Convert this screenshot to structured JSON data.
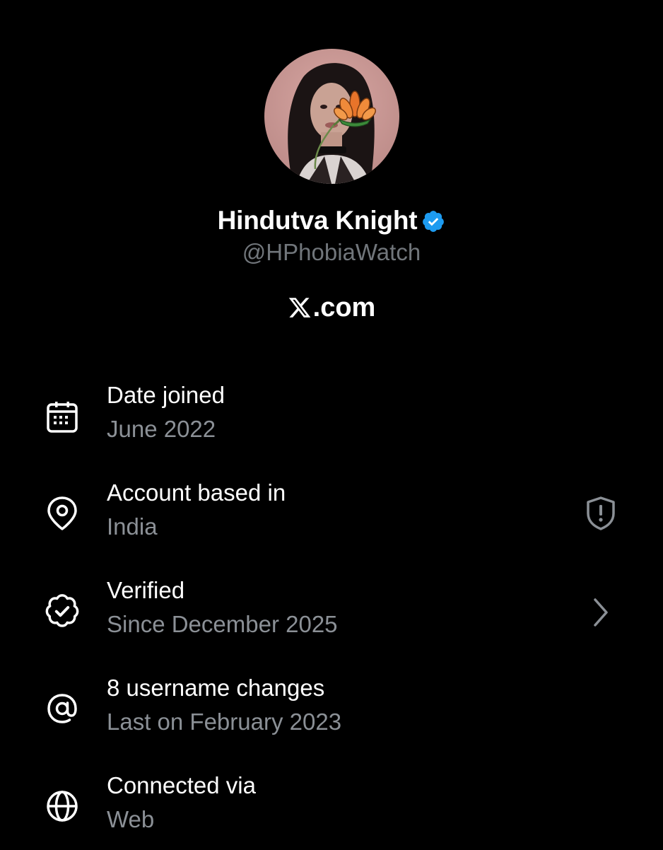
{
  "profile": {
    "display_name": "Hindutva Knight",
    "handle": "@HPhobiaWatch",
    "site_text": ".com",
    "avatar_icon": "avatar-photo",
    "verified_color": "#1d9bf0"
  },
  "about_rows": [
    {
      "icon": "calendar-icon",
      "title": "Date joined",
      "subtitle": "June 2022",
      "action": null
    },
    {
      "icon": "location-pin-icon",
      "title": "Account based in",
      "subtitle": "India",
      "action": "shield-alert-icon"
    },
    {
      "icon": "verified-badge-icon",
      "title": "Verified",
      "subtitle": "Since December 2025",
      "action": "chevron-right-icon"
    },
    {
      "icon": "at-sign-icon",
      "title": "8 username changes",
      "subtitle": "Last on February 2023",
      "action": null
    },
    {
      "icon": "globe-icon",
      "title": "Connected via",
      "subtitle": "Web",
      "action": null
    }
  ],
  "colors": {
    "background": "#000000",
    "primary_text": "#ffffff",
    "secondary_text": "#71767b",
    "accent": "#1d9bf0"
  }
}
